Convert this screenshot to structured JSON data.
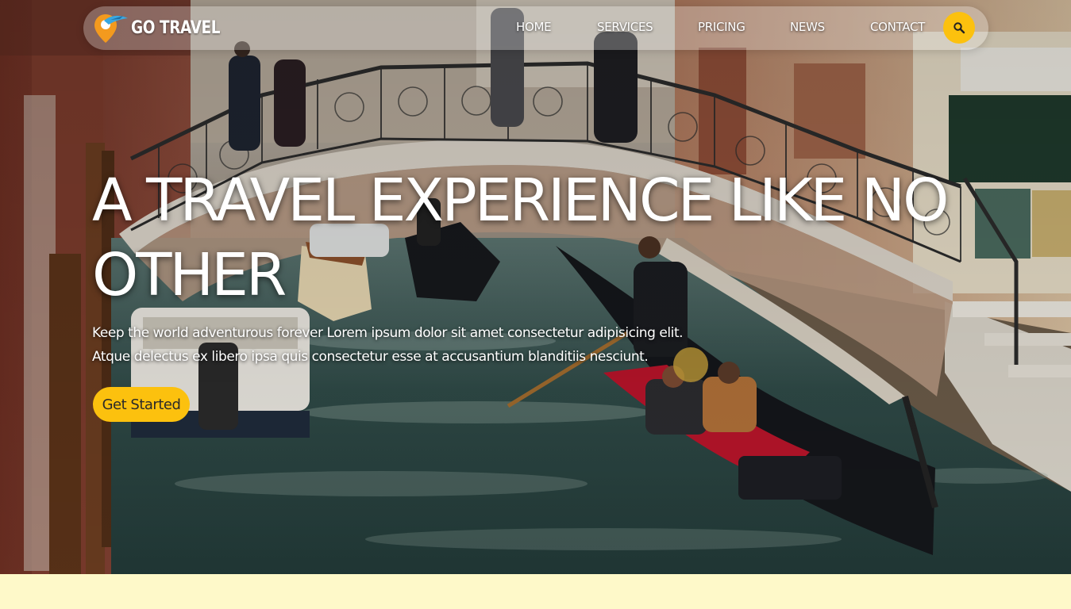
{
  "brand": {
    "name": "GO TRAVEL",
    "logo_icon": "map-pin-plane-icon"
  },
  "nav": {
    "items": [
      {
        "label": "HOME"
      },
      {
        "label": "SERVICES"
      },
      {
        "label": "PRICING"
      },
      {
        "label": "NEWS"
      },
      {
        "label": "CONTACT"
      }
    ],
    "search_icon": "search-icon"
  },
  "hero": {
    "headline": "A TRAVEL EXPERIENCE LIKE NO OTHER",
    "subtext_line1": "Keep the world adventurous forever Lorem ipsum dolor sit amet consectetur adipisicing elit.",
    "subtext_line2": "Atque delectus ex libero ipsa quis consectetur esse at accusantium blanditiis nesciunt.",
    "cta_label": "Get Started"
  },
  "colors": {
    "accent": "#fcc10e",
    "page_background": "#fef9c9",
    "text": "#ffffff"
  }
}
